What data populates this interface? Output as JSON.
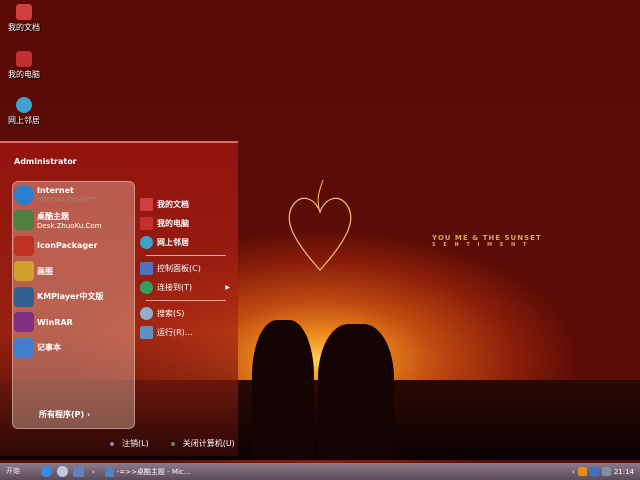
{
  "desktop": {
    "icons": [
      {
        "label": "我的文档",
        "color": "#d04040"
      },
      {
        "label": "我的电脑",
        "color": "#c03030"
      },
      {
        "label": "网上邻居",
        "color": "#40a0d0"
      }
    ],
    "wallpaper_text": {
      "line1": "YOU  ME & THE SUNSET",
      "line2": "S E N T I M E N T"
    }
  },
  "start_menu": {
    "user": "Administrator",
    "left_items": [
      {
        "label": "Internet",
        "sub": "Internet Explorer",
        "color": "#2a80d0"
      },
      {
        "label": "桌酷主题",
        "sub": "Desk.ZhuoKu.Com",
        "color": "#508040"
      },
      {
        "label": "IconPackager",
        "color": "#c03020"
      },
      {
        "label": "画图",
        "color": "#d0a030"
      },
      {
        "label": "KMPlayer中文版",
        "color": "#306090"
      },
      {
        "label": "WinRAR",
        "color": "#803080"
      },
      {
        "label": "记事本",
        "color": "#4080d0"
      }
    ],
    "all_programs": "所有程序(P)",
    "right_items": [
      {
        "label": "我的文档",
        "color": "#d04040"
      },
      {
        "label": "我的电脑",
        "color": "#c03030"
      },
      {
        "label": "网上邻居",
        "color": "#40a0d0"
      },
      {
        "label": "控制面板(C)",
        "color": "#5070c0"
      },
      {
        "label": "连接到(T)",
        "color": "#30a060"
      },
      {
        "label": "搜索(S)",
        "color": "#90b0d0"
      },
      {
        "label": "运行(R)...",
        "color": "#6090c0"
      }
    ],
    "logoff": "注销(L)",
    "shutdown": "关闭计算机(U)"
  },
  "taskbar": {
    "start": "开始",
    "task": "-=>>桌酷主题 - Mic...",
    "clock": "21:14"
  }
}
